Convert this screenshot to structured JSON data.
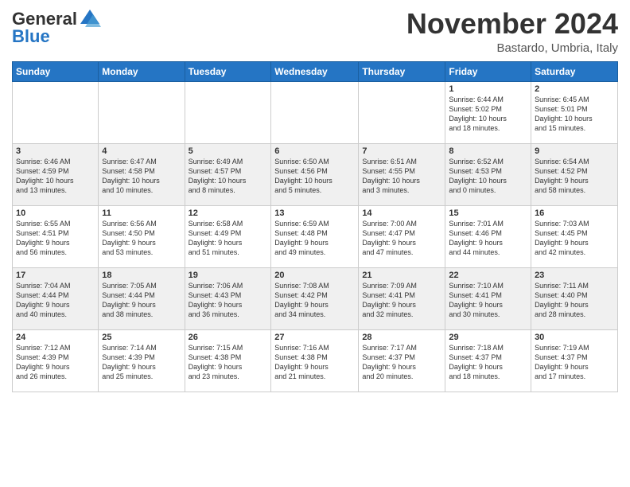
{
  "header": {
    "logo": {
      "line1": "General",
      "line2": "Blue"
    },
    "title": "November 2024",
    "location": "Bastardo, Umbria, Italy"
  },
  "calendar": {
    "days_of_week": [
      "Sunday",
      "Monday",
      "Tuesday",
      "Wednesday",
      "Thursday",
      "Friday",
      "Saturday"
    ],
    "weeks": [
      [
        {
          "day": "",
          "info": ""
        },
        {
          "day": "",
          "info": ""
        },
        {
          "day": "",
          "info": ""
        },
        {
          "day": "",
          "info": ""
        },
        {
          "day": "",
          "info": ""
        },
        {
          "day": "1",
          "info": "Sunrise: 6:44 AM\nSunset: 5:02 PM\nDaylight: 10 hours\nand 18 minutes."
        },
        {
          "day": "2",
          "info": "Sunrise: 6:45 AM\nSunset: 5:01 PM\nDaylight: 10 hours\nand 15 minutes."
        }
      ],
      [
        {
          "day": "3",
          "info": "Sunrise: 6:46 AM\nSunset: 4:59 PM\nDaylight: 10 hours\nand 13 minutes."
        },
        {
          "day": "4",
          "info": "Sunrise: 6:47 AM\nSunset: 4:58 PM\nDaylight: 10 hours\nand 10 minutes."
        },
        {
          "day": "5",
          "info": "Sunrise: 6:49 AM\nSunset: 4:57 PM\nDaylight: 10 hours\nand 8 minutes."
        },
        {
          "day": "6",
          "info": "Sunrise: 6:50 AM\nSunset: 4:56 PM\nDaylight: 10 hours\nand 5 minutes."
        },
        {
          "day": "7",
          "info": "Sunrise: 6:51 AM\nSunset: 4:55 PM\nDaylight: 10 hours\nand 3 minutes."
        },
        {
          "day": "8",
          "info": "Sunrise: 6:52 AM\nSunset: 4:53 PM\nDaylight: 10 hours\nand 0 minutes."
        },
        {
          "day": "9",
          "info": "Sunrise: 6:54 AM\nSunset: 4:52 PM\nDaylight: 9 hours\nand 58 minutes."
        }
      ],
      [
        {
          "day": "10",
          "info": "Sunrise: 6:55 AM\nSunset: 4:51 PM\nDaylight: 9 hours\nand 56 minutes."
        },
        {
          "day": "11",
          "info": "Sunrise: 6:56 AM\nSunset: 4:50 PM\nDaylight: 9 hours\nand 53 minutes."
        },
        {
          "day": "12",
          "info": "Sunrise: 6:58 AM\nSunset: 4:49 PM\nDaylight: 9 hours\nand 51 minutes."
        },
        {
          "day": "13",
          "info": "Sunrise: 6:59 AM\nSunset: 4:48 PM\nDaylight: 9 hours\nand 49 minutes."
        },
        {
          "day": "14",
          "info": "Sunrise: 7:00 AM\nSunset: 4:47 PM\nDaylight: 9 hours\nand 47 minutes."
        },
        {
          "day": "15",
          "info": "Sunrise: 7:01 AM\nSunset: 4:46 PM\nDaylight: 9 hours\nand 44 minutes."
        },
        {
          "day": "16",
          "info": "Sunrise: 7:03 AM\nSunset: 4:45 PM\nDaylight: 9 hours\nand 42 minutes."
        }
      ],
      [
        {
          "day": "17",
          "info": "Sunrise: 7:04 AM\nSunset: 4:44 PM\nDaylight: 9 hours\nand 40 minutes."
        },
        {
          "day": "18",
          "info": "Sunrise: 7:05 AM\nSunset: 4:44 PM\nDaylight: 9 hours\nand 38 minutes."
        },
        {
          "day": "19",
          "info": "Sunrise: 7:06 AM\nSunset: 4:43 PM\nDaylight: 9 hours\nand 36 minutes."
        },
        {
          "day": "20",
          "info": "Sunrise: 7:08 AM\nSunset: 4:42 PM\nDaylight: 9 hours\nand 34 minutes."
        },
        {
          "day": "21",
          "info": "Sunrise: 7:09 AM\nSunset: 4:41 PM\nDaylight: 9 hours\nand 32 minutes."
        },
        {
          "day": "22",
          "info": "Sunrise: 7:10 AM\nSunset: 4:41 PM\nDaylight: 9 hours\nand 30 minutes."
        },
        {
          "day": "23",
          "info": "Sunrise: 7:11 AM\nSunset: 4:40 PM\nDaylight: 9 hours\nand 28 minutes."
        }
      ],
      [
        {
          "day": "24",
          "info": "Sunrise: 7:12 AM\nSunset: 4:39 PM\nDaylight: 9 hours\nand 26 minutes."
        },
        {
          "day": "25",
          "info": "Sunrise: 7:14 AM\nSunset: 4:39 PM\nDaylight: 9 hours\nand 25 minutes."
        },
        {
          "day": "26",
          "info": "Sunrise: 7:15 AM\nSunset: 4:38 PM\nDaylight: 9 hours\nand 23 minutes."
        },
        {
          "day": "27",
          "info": "Sunrise: 7:16 AM\nSunset: 4:38 PM\nDaylight: 9 hours\nand 21 minutes."
        },
        {
          "day": "28",
          "info": "Sunrise: 7:17 AM\nSunset: 4:37 PM\nDaylight: 9 hours\nand 20 minutes."
        },
        {
          "day": "29",
          "info": "Sunrise: 7:18 AM\nSunset: 4:37 PM\nDaylight: 9 hours\nand 18 minutes."
        },
        {
          "day": "30",
          "info": "Sunrise: 7:19 AM\nSunset: 4:37 PM\nDaylight: 9 hours\nand 17 minutes."
        }
      ]
    ]
  }
}
